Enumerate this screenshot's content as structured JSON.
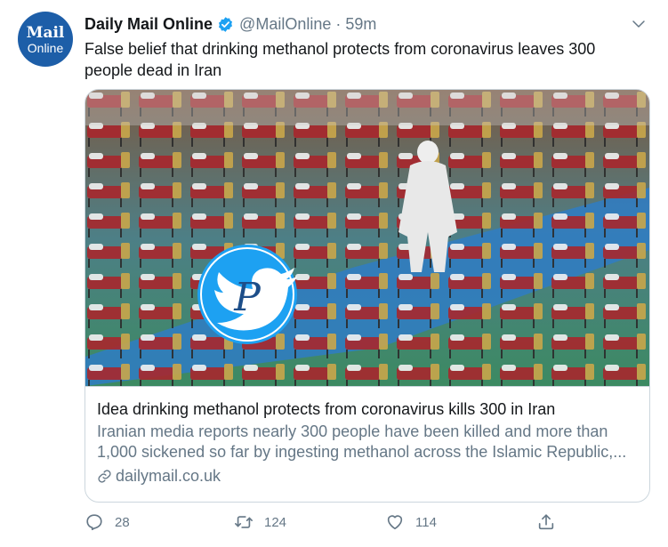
{
  "tweet": {
    "avatar_line1": "Mail",
    "avatar_line2": "Online",
    "display_name": "Daily Mail Online",
    "handle": "@MailOnline",
    "separator": "·",
    "time": "59m",
    "text": "False belief that drinking methanol protects from coronavirus leaves 300 people dead in Iran"
  },
  "card": {
    "title": "Idea drinking methanol protects from coronavirus kills 300 in Iran",
    "description": "Iranian media reports nearly 300 people have been killed and more than 1,000 sickened so far by ingesting methanol across the Islamic Republic,...",
    "domain": "dailymail.co.uk",
    "image_description": "photo-of-field-hospital-beds-with-person-in-protective-suit",
    "watermark_letter": "P"
  },
  "actions": {
    "reply_count": "28",
    "retweet_count": "124",
    "like_count": "114"
  },
  "icons": {
    "verified": "verified-badge-icon",
    "caret": "chevron-down-icon",
    "link": "link-icon",
    "reply": "reply-icon",
    "retweet": "retweet-icon",
    "like": "heart-icon",
    "share": "share-icon",
    "watermark": "twitter-bird-watermark-icon"
  },
  "colors": {
    "brand_blue": "#1da1f2",
    "avatar_blue": "#1d5ea8",
    "secondary_text": "#657786",
    "border": "#ccd6dd"
  }
}
